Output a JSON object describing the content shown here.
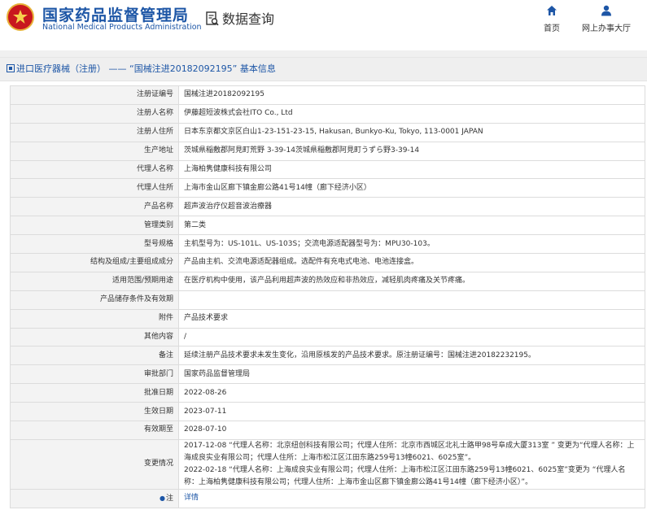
{
  "header": {
    "site_title": "国家药品监督管理局",
    "site_subtitle": "National Medical Products Administration",
    "db_query": "数据查询",
    "nav_home": "首页",
    "nav_online": "网上办事大厅"
  },
  "breadcrumb": "进口医疗器械（注册） —— “国械注进20182092195” 基本信息",
  "rows": [
    {
      "label": "注册证编号",
      "value": "国械注进20182092195"
    },
    {
      "label": "注册人名称",
      "value": "伊藤超短波株式会社ITO Co., Ltd"
    },
    {
      "label": "注册人住所",
      "value": "日本东京都文京区白山1-23-151-23-15, Hakusan, Bunkyo-Ku, Tokyo, 113-0001 JAPAN"
    },
    {
      "label": "生产地址",
      "value": "茨城県稲敷郡阿見町荒野 3-39-14茨城県稲敷郡阿見町うずら野3-39-14"
    },
    {
      "label": "代理人名称",
      "value": "上海柏隽健康科技有限公司"
    },
    {
      "label": "代理人住所",
      "value": "上海市金山区廊下镇金廊公路41号14幢（廊下经济小区）"
    },
    {
      "label": "产品名称",
      "value": "超声波治疗仪超音波治療器"
    },
    {
      "label": "管理类别",
      "value": "第二类"
    },
    {
      "label": "型号规格",
      "value": "主机型号为：US-101L、US-103S；交流电源适配器型号为：MPU30-103。"
    },
    {
      "label": "结构及组成/主要组成成分",
      "value": "产品由主机、交流电源适配器组成。选配件有充电式电池、电池连接盒。"
    },
    {
      "label": "适用范围/预期用途",
      "value": "在医疗机构中使用，该产品利用超声波的热效应和非热效应，减轻肌肉疼痛及关节疼痛。"
    },
    {
      "label": "产品储存条件及有效期",
      "value": ""
    },
    {
      "label": "附件",
      "value": "产品技术要求"
    },
    {
      "label": "其他内容",
      "value": "/"
    },
    {
      "label": "备注",
      "value": "延续注册产品技术要求未发生变化，沿用原核发的产品技术要求。原注册证编号：国械注进20182232195。"
    },
    {
      "label": "审批部门",
      "value": "国家药品监督管理局"
    },
    {
      "label": "批准日期",
      "value": "2022-08-26"
    },
    {
      "label": "生效日期",
      "value": "2023-07-11"
    },
    {
      "label": "有效期至",
      "value": "2028-07-10"
    }
  ],
  "changes": {
    "label": "变更情况",
    "entries": [
      "2017-12-08 “代理人名称：北京纽创科技有限公司；代理人住所：北京市西城区北礼士路甲98号阜成大厦313室 ” 变更为“代理人名称：上海成良实业有限公司；代理人住所：上海市松江区江田东路259号13幢6021、6025室”。",
      "2022-02-18 “代理人名称：上海成良实业有限公司；代理人住所：上海市松江区江田东路259号13幢6021、6025室”变更为 “代理人名称：上海柏隽健康科技有限公司；代理人住所：上海市金山区廊下镇金廊公路41号14幢（廊下经济小区）”。"
    ]
  },
  "note": {
    "label": "注",
    "icon": "note-icon",
    "link": "详情"
  },
  "colors": {
    "brand_blue": "#1d56a6",
    "emblem_red": "#c8171e",
    "label_bg": "#f3f3f3"
  }
}
